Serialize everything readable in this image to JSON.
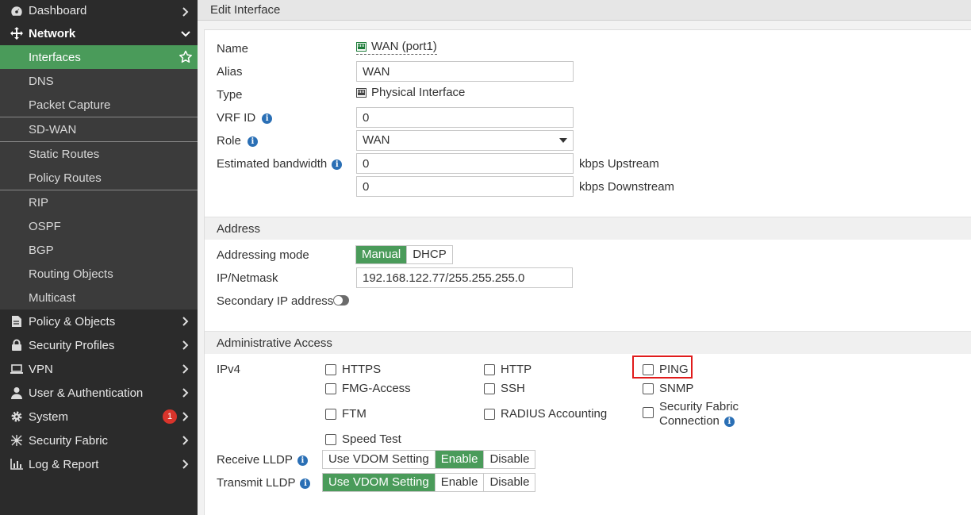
{
  "sidebar": {
    "dashboard": "Dashboard",
    "network": "Network",
    "network_items": [
      {
        "label": "Interfaces"
      },
      {
        "label": "DNS"
      },
      {
        "label": "Packet Capture"
      },
      {
        "label": "SD-WAN"
      },
      {
        "label": "Static Routes"
      },
      {
        "label": "Policy Routes"
      },
      {
        "label": "RIP"
      },
      {
        "label": "OSPF"
      },
      {
        "label": "BGP"
      },
      {
        "label": "Routing Objects"
      },
      {
        "label": "Multicast"
      }
    ],
    "policy_objects": "Policy & Objects",
    "security_profiles": "Security Profiles",
    "vpn": "VPN",
    "user_auth": "User & Authentication",
    "system": "System",
    "system_badge": "1",
    "security_fabric": "Security Fabric",
    "log_report": "Log & Report"
  },
  "header": {
    "title": "Edit Interface"
  },
  "form": {
    "name_label": "Name",
    "name_value": "WAN (port1)",
    "alias_label": "Alias",
    "alias_value": "WAN",
    "type_label": "Type",
    "type_value": "Physical Interface",
    "vrf_label": "VRF ID",
    "vrf_value": "0",
    "role_label": "Role",
    "role_value": "WAN",
    "bandwidth_label": "Estimated bandwidth",
    "upstream_value": "0",
    "upstream_unit": "kbps Upstream",
    "downstream_value": "0",
    "downstream_unit": "kbps Downstream"
  },
  "address": {
    "section_title": "Address",
    "mode_label": "Addressing mode",
    "mode_manual": "Manual",
    "mode_dhcp": "DHCP",
    "ip_label": "IP/Netmask",
    "ip_value": "192.168.122.77/255.255.255.0",
    "secondary_label": "Secondary IP address"
  },
  "admin": {
    "section_title": "Administrative Access",
    "ipv4_label": "IPv4",
    "https": "HTTPS",
    "http": "HTTP",
    "ping": "PING",
    "fmg": "FMG-Access",
    "ssh": "SSH",
    "snmp": "SNMP",
    "ftm": "FTM",
    "radius": "RADIUS Accounting",
    "fabric_line1": "Security Fabric",
    "fabric_line2": "Connection",
    "speed": "Speed Test",
    "receive_label": "Receive LLDP",
    "transmit_label": "Transmit LLDP",
    "opt_vdom": "Use VDOM Setting",
    "opt_enable": "Enable",
    "opt_disable": "Disable"
  },
  "colors": {
    "accent": "#4a9b5a",
    "sidebar_bg": "#2b2b2b",
    "highlight": "#e01b1b",
    "info": "#2a6fb5",
    "badge": "#d9342b"
  }
}
